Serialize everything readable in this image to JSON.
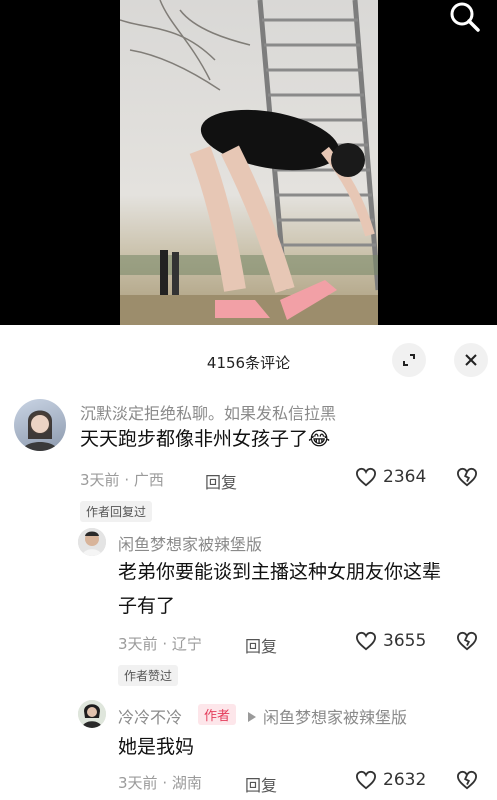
{
  "header": {
    "comment_count": "4156条评论"
  },
  "comments": [
    {
      "username": "沉默淡定拒绝私聊。如果发私信拉黑",
      "text": "天天跑步都像非州女孩子了",
      "emoji": "😂",
      "time": "3天前",
      "location": "· 广西",
      "reply": "回复",
      "likes": "2364",
      "badge": "作者回复过"
    },
    {
      "username": "闲鱼梦想家被辣堡版",
      "text_line1": "老弟你要能谈到主播这种女朋友你这辈",
      "text_line2": "子有了",
      "time": "3天前",
      "location": "· 辽宁",
      "reply": "回复",
      "likes": "3655",
      "badge": "作者赞过"
    },
    {
      "username": "冷冷不冷",
      "author_tag": "作者",
      "reply_to": "闲鱼梦想家被辣堡版",
      "text": "她是我妈",
      "time": "3天前",
      "location": "· 湖南",
      "reply": "回复",
      "likes": "2632"
    }
  ]
}
